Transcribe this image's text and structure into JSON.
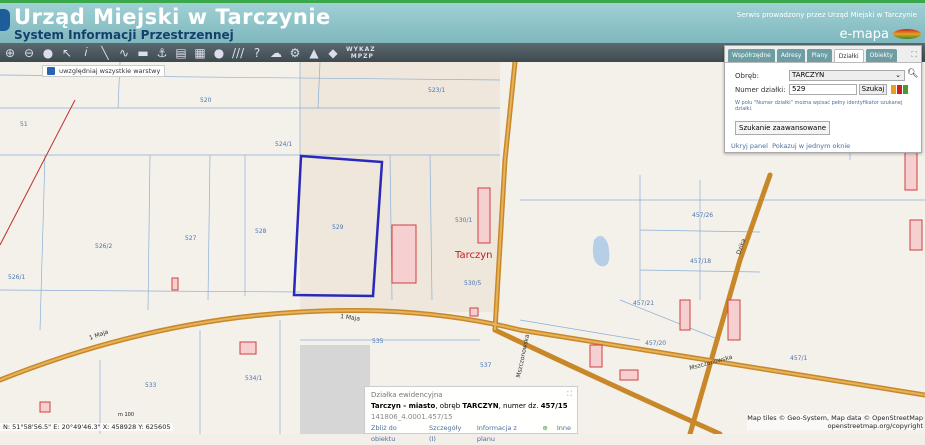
{
  "header": {
    "title": "Urząd Miejski w Tarczynie",
    "subtitle": "System Informacji Przestrzennej",
    "service": "Serwis prowadzony przez Urząd Miejski w Tarczynie",
    "brand": "e-mapa"
  },
  "toolbar": {
    "wykaz": "WYKAZ",
    "mpzp": "MPZP"
  },
  "layers_checkbox": {
    "label": "uwzględniaj wszystkie warstwy",
    "checked": true
  },
  "panel": {
    "tabs": [
      "Współrzędne",
      "Adresy",
      "Plany",
      "Działki",
      "Obiekty"
    ],
    "active_tab": "Działki",
    "obreb_label": "Obręb:",
    "obreb_value": "TARCZYN",
    "numer_label": "Numer działki:",
    "numer_value": "529",
    "search_button": "Szukaj",
    "hint": "W polu \"Numer działki\" można wpisać pełny identyfikator szukanej działki.",
    "advanced_button": "Szukanie zaawansowane",
    "hide_link": "Ukryj panel",
    "show_link": "Pokazuj w jednym oknie"
  },
  "info": {
    "heading": "Działka ewidencyjna",
    "place": "Tarczyn - miasto",
    "obreb_text": ", obręb ",
    "obreb": "TARCZYN",
    "numer_text": ", numer dz. ",
    "numer": "457/15",
    "id": "141806_4.0001.457/15",
    "links": [
      "Zbliż do obiektu",
      "Szczegóły (I)",
      "Informacja z planu",
      "Inne"
    ]
  },
  "map": {
    "labels": {
      "p520": "520",
      "p523": "523/1",
      "p51": "51",
      "p524": "524/1",
      "p529": "529",
      "p530": "530/1",
      "p526_2": "526/2",
      "p527": "527",
      "p528": "528",
      "p526_1": "526/1",
      "town": "Tarczyn",
      "p530_5": "530/5",
      "p535": "535",
      "p537": "537",
      "p534": "534/1",
      "p533": "533",
      "p457_26": "457/26",
      "p457_18": "457/18",
      "p457_21": "457/21",
      "p457_20": "457/20",
      "p457_1": "457/1",
      "street1": "Mszczonowska",
      "street2": "Mszczonowska",
      "street3": "1 Maja",
      "street4": "1 Maja",
      "street5": "Dzika"
    }
  },
  "status": {
    "coords": "N: 51°58'56.5\"  E: 20°49'46.3\"  X: 458928  Y: 625605",
    "scale": "m 100"
  },
  "attribution": {
    "line1": "Map tiles © Geo-System, Map data © OpenStreetMap",
    "line2": "openstreetmap.org/copyright"
  },
  "colors": {
    "header": "#8cc3c9",
    "toolbar": "#4a5a60",
    "road": "#c8882a",
    "selection": "#2a2ab8",
    "buildings": "#d04040"
  }
}
